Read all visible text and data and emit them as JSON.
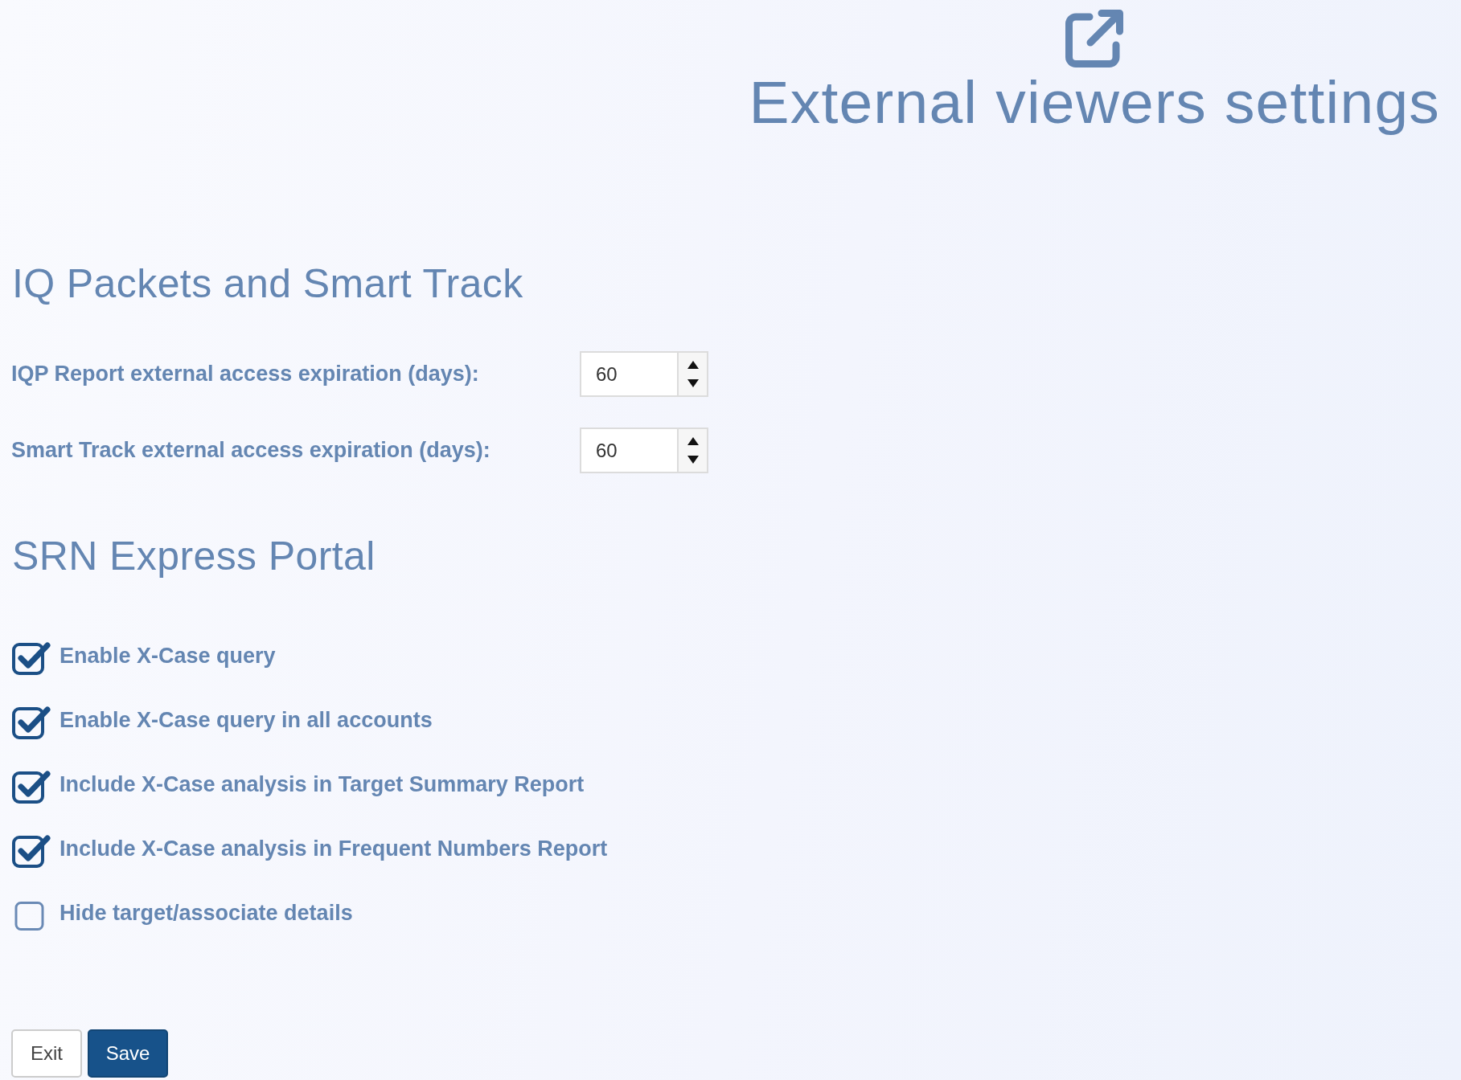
{
  "header": {
    "title": "External viewers settings"
  },
  "iq_section": {
    "title": "IQ Packets and Smart Track",
    "fields": [
      {
        "label": "IQP Report external access expiration (days):",
        "value": "60"
      },
      {
        "label": "Smart Track external access expiration (days):",
        "value": "60"
      }
    ]
  },
  "srn_section": {
    "title": "SRN Express Portal",
    "options": [
      {
        "label": "Enable X-Case query",
        "checked": true
      },
      {
        "label": "Enable X-Case query in all accounts",
        "checked": true
      },
      {
        "label": "Include X-Case analysis in Target Summary Report",
        "checked": true
      },
      {
        "label": "Include X-Case analysis in Frequent Numbers Report",
        "checked": true
      },
      {
        "label": "Hide target/associate details",
        "checked": false
      }
    ]
  },
  "buttons": [
    {
      "label": "Exit",
      "kind": "secondary"
    },
    {
      "label": "Save",
      "kind": "primary"
    }
  ]
}
